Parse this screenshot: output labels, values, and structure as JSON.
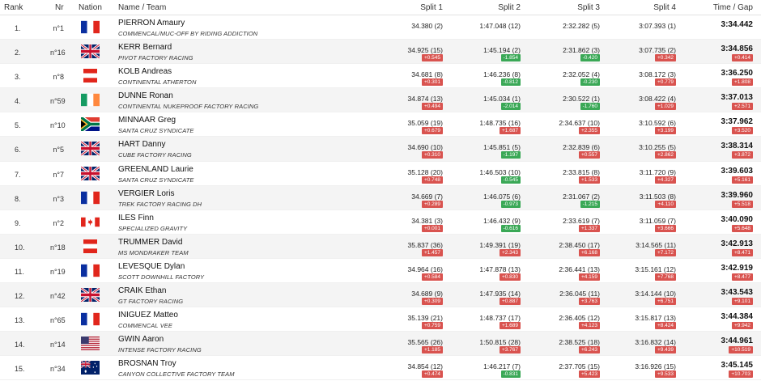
{
  "header": {
    "rank": "Rank",
    "nr": "Nr",
    "nation": "Nation",
    "name_team": "Name / Team",
    "split1": "Split 1",
    "split2": "Split 2",
    "split3": "Split 3",
    "split4": "Split 4",
    "time_gap": "Time / Gap"
  },
  "colors": {
    "gap_red": "#d9534f",
    "gap_green": "#3aa856",
    "row_alt": "#f4f4f4"
  },
  "riders": [
    {
      "rank": "1.",
      "nr": "n°1",
      "flag": "france",
      "name": "PIERRON Amaury",
      "team": "COMMENCAL/MUC-OFF BY RIDING ADDICTION",
      "splits": [
        {
          "t": "34.380 (2)",
          "g": "",
          "c": ""
        },
        {
          "t": "1:47.048 (12)",
          "g": "",
          "c": ""
        },
        {
          "t": "2:32.282 (5)",
          "g": "",
          "c": ""
        },
        {
          "t": "3:07.393 (1)",
          "g": "",
          "c": ""
        }
      ],
      "time": "3:34.442",
      "gap": ""
    },
    {
      "rank": "2.",
      "nr": "n°16",
      "flag": "uk",
      "name": "KERR Bernard",
      "team": "PIVOT FACTORY RACING",
      "splits": [
        {
          "t": "34.925 (15)",
          "g": "+0.545",
          "c": "red"
        },
        {
          "t": "1:45.194 (2)",
          "g": "-1.854",
          "c": "green"
        },
        {
          "t": "2:31.862 (3)",
          "g": "-0.420",
          "c": "green"
        },
        {
          "t": "3:07.735 (2)",
          "g": "+0.342",
          "c": "red"
        }
      ],
      "time": "3:34.856",
      "gap": "+0.414"
    },
    {
      "rank": "3.",
      "nr": "n°8",
      "flag": "austria",
      "name": "KOLB Andreas",
      "team": "CONTINENTAL ATHERTON",
      "splits": [
        {
          "t": "34.681 (8)",
          "g": "+0.301",
          "c": "red"
        },
        {
          "t": "1:46.236 (8)",
          "g": "-0.812",
          "c": "green"
        },
        {
          "t": "2:32.052 (4)",
          "g": "-0.230",
          "c": "green"
        },
        {
          "t": "3:08.172 (3)",
          "g": "+0.779",
          "c": "red"
        }
      ],
      "time": "3:36.250",
      "gap": "+1.808"
    },
    {
      "rank": "4.",
      "nr": "n°59",
      "flag": "ireland",
      "name": "DUNNE Ronan",
      "team": "CONTINENTAL NUKEPROOF FACTORY RACING",
      "splits": [
        {
          "t": "34.874 (13)",
          "g": "+0.494",
          "c": "red"
        },
        {
          "t": "1:45.034 (1)",
          "g": "-2.014",
          "c": "green"
        },
        {
          "t": "2:30.522 (1)",
          "g": "-1.760",
          "c": "green"
        },
        {
          "t": "3:08.422 (4)",
          "g": "+1.029",
          "c": "red"
        }
      ],
      "time": "3:37.013",
      "gap": "+2.571"
    },
    {
      "rank": "5.",
      "nr": "n°10",
      "flag": "southafrica",
      "name": "MINNAAR Greg",
      "team": "SANTA CRUZ SYNDICATE",
      "splits": [
        {
          "t": "35.059 (19)",
          "g": "+0.679",
          "c": "red"
        },
        {
          "t": "1:48.735 (16)",
          "g": "+1.687",
          "c": "red"
        },
        {
          "t": "2:34.637 (10)",
          "g": "+2.355",
          "c": "red"
        },
        {
          "t": "3:10.592 (6)",
          "g": "+3.199",
          "c": "red"
        }
      ],
      "time": "3:37.962",
      "gap": "+3.520"
    },
    {
      "rank": "6.",
      "nr": "n°5",
      "flag": "uk",
      "name": "HART Danny",
      "team": "CUBE FACTORY RACING",
      "splits": [
        {
          "t": "34.690 (10)",
          "g": "+0.310",
          "c": "red"
        },
        {
          "t": "1:45.851 (5)",
          "g": "-1.197",
          "c": "green"
        },
        {
          "t": "2:32.839 (6)",
          "g": "+0.557",
          "c": "red"
        },
        {
          "t": "3:10.255 (5)",
          "g": "+2.862",
          "c": "red"
        }
      ],
      "time": "3:38.314",
      "gap": "+3.872"
    },
    {
      "rank": "7.",
      "nr": "n°7",
      "flag": "uk",
      "name": "GREENLAND Laurie",
      "team": "SANTA CRUZ SYNDICATE",
      "splits": [
        {
          "t": "35.128 (20)",
          "g": "+0.748",
          "c": "red"
        },
        {
          "t": "1:46.503 (10)",
          "g": "-0.545",
          "c": "green"
        },
        {
          "t": "2:33.815 (8)",
          "g": "+1.533",
          "c": "red"
        },
        {
          "t": "3:11.720 (9)",
          "g": "+4.327",
          "c": "red"
        }
      ],
      "time": "3:39.603",
      "gap": "+5.161"
    },
    {
      "rank": "8.",
      "nr": "n°3",
      "flag": "france",
      "name": "VERGIER Loris",
      "team": "TREK FACTORY RACING DH",
      "splits": [
        {
          "t": "34.669 (7)",
          "g": "+0.289",
          "c": "red"
        },
        {
          "t": "1:46.075 (6)",
          "g": "-0.973",
          "c": "green"
        },
        {
          "t": "2:31.067 (2)",
          "g": "-1.215",
          "c": "green"
        },
        {
          "t": "3:11.503 (8)",
          "g": "+4.110",
          "c": "red"
        }
      ],
      "time": "3:39.960",
      "gap": "+5.518"
    },
    {
      "rank": "9.",
      "nr": "n°2",
      "flag": "canada",
      "name": "ILES Finn",
      "team": "SPECIALIZED GRAVITY",
      "splits": [
        {
          "t": "34.381 (3)",
          "g": "+0.001",
          "c": "red"
        },
        {
          "t": "1:46.432 (9)",
          "g": "-0.616",
          "c": "green"
        },
        {
          "t": "2:33.619 (7)",
          "g": "+1.337",
          "c": "red"
        },
        {
          "t": "3:11.059 (7)",
          "g": "+3.666",
          "c": "red"
        }
      ],
      "time": "3:40.090",
      "gap": "+5.648"
    },
    {
      "rank": "10.",
      "nr": "n°18",
      "flag": "austria",
      "name": "TRUMMER David",
      "team": "MS MONDRAKER TEAM",
      "splits": [
        {
          "t": "35.837 (36)",
          "g": "+1.457",
          "c": "red"
        },
        {
          "t": "1:49.391 (19)",
          "g": "+2.343",
          "c": "red"
        },
        {
          "t": "2:38.450 (17)",
          "g": "+6.168",
          "c": "red"
        },
        {
          "t": "3:14.565 (11)",
          "g": "+7.172",
          "c": "red"
        }
      ],
      "time": "3:42.913",
      "gap": "+8.471"
    },
    {
      "rank": "11.",
      "nr": "n°19",
      "flag": "france",
      "name": "LEVESQUE Dylan",
      "team": "SCOTT DOWNHILL FACTORY",
      "splits": [
        {
          "t": "34.964 (16)",
          "g": "+0.584",
          "c": "red"
        },
        {
          "t": "1:47.878 (13)",
          "g": "+0.830",
          "c": "red"
        },
        {
          "t": "2:36.441 (13)",
          "g": "+4.159",
          "c": "red"
        },
        {
          "t": "3:15.161 (12)",
          "g": "+7.768",
          "c": "red"
        }
      ],
      "time": "3:42.919",
      "gap": "+8.477"
    },
    {
      "rank": "12.",
      "nr": "n°42",
      "flag": "uk",
      "name": "CRAIK Ethan",
      "team": "GT FACTORY RACING",
      "splits": [
        {
          "t": "34.689 (9)",
          "g": "+0.309",
          "c": "red"
        },
        {
          "t": "1:47.935 (14)",
          "g": "+0.887",
          "c": "red"
        },
        {
          "t": "2:36.045 (11)",
          "g": "+3.763",
          "c": "red"
        },
        {
          "t": "3:14.144 (10)",
          "g": "+6.751",
          "c": "red"
        }
      ],
      "time": "3:43.543",
      "gap": "+9.101"
    },
    {
      "rank": "13.",
      "nr": "n°65",
      "flag": "france",
      "name": "INIGUEZ Matteo",
      "team": "COMMENCAL VEE",
      "splits": [
        {
          "t": "35.139 (21)",
          "g": "+0.759",
          "c": "red"
        },
        {
          "t": "1:48.737 (17)",
          "g": "+1.689",
          "c": "red"
        },
        {
          "t": "2:36.405 (12)",
          "g": "+4.123",
          "c": "red"
        },
        {
          "t": "3:15.817 (13)",
          "g": "+8.424",
          "c": "red"
        }
      ],
      "time": "3:44.384",
      "gap": "+9.942"
    },
    {
      "rank": "14.",
      "nr": "n°14",
      "flag": "usa",
      "name": "GWIN Aaron",
      "team": "INTENSE FACTORY RACING",
      "splits": [
        {
          "t": "35.565 (26)",
          "g": "+1.185",
          "c": "red"
        },
        {
          "t": "1:50.815 (28)",
          "g": "+3.767",
          "c": "red"
        },
        {
          "t": "2:38.525 (18)",
          "g": "+6.243",
          "c": "red"
        },
        {
          "t": "3:16.832 (14)",
          "g": "+9.439",
          "c": "red"
        }
      ],
      "time": "3:44.961",
      "gap": "+10.519"
    },
    {
      "rank": "15.",
      "nr": "n°34",
      "flag": "australia",
      "name": "BROSNAN Troy",
      "team": "CANYON COLLECTIVE FACTORY TEAM",
      "splits": [
        {
          "t": "34.854 (12)",
          "g": "+0.474",
          "c": "red"
        },
        {
          "t": "1:46.217 (7)",
          "g": "-0.831",
          "c": "green"
        },
        {
          "t": "2:37.705 (15)",
          "g": "+5.423",
          "c": "red"
        },
        {
          "t": "3:16.926 (15)",
          "g": "+9.533",
          "c": "red"
        }
      ],
      "time": "3:45.145",
      "gap": "+10.703"
    }
  ]
}
